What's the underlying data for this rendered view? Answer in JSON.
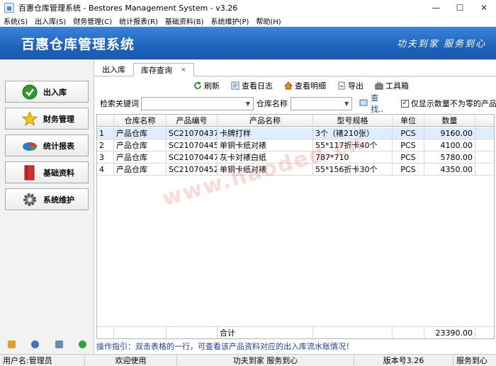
{
  "window": {
    "title": "百惠仓库管理系统 - Bestores Management System - v3.26",
    "minimize": "—",
    "maximize": "☐",
    "close": "✕"
  },
  "menu": [
    "系统(S)",
    "出入库(S)",
    "财务管理(C)",
    "统计报表(R)",
    "基础资料(B)",
    "系统维护(P)",
    "帮助(H)"
  ],
  "banner": {
    "title": "百惠仓库管理系统",
    "slogan": "功夫到家 服务到心"
  },
  "sidebar": {
    "buttons": [
      {
        "label": "出入库",
        "icon": "check-icon"
      },
      {
        "label": "财务管理",
        "icon": "star-icon"
      },
      {
        "label": "统计报表",
        "icon": "pie-chart-icon"
      },
      {
        "label": "基础资料",
        "icon": "book-icon"
      },
      {
        "label": "系统维护",
        "icon": "gear-icon"
      }
    ]
  },
  "tabs": [
    {
      "label": "出入库"
    },
    {
      "label": "库存查询",
      "close": "×"
    }
  ],
  "toolbar": {
    "refresh": "刷新",
    "view_log": "查看日志",
    "view_detail": "查看明细",
    "export": "导出",
    "toolbox": "工具箱"
  },
  "search": {
    "keyword_label": "检索关键词",
    "keyword_value": "",
    "warehouse_label": "仓库名称",
    "warehouse_value": "",
    "find": "查找..",
    "checkbox_label": "仅显示数量不为零的产品",
    "checkbox_checked": true
  },
  "table": {
    "headers": [
      "",
      "仓库名称",
      "产品编号",
      "产品名称",
      "型号规格",
      "单位",
      "数量"
    ],
    "rows": [
      [
        "1",
        "产品仓库",
        "SC21070437",
        "卡牌打样",
        "3个（裱210张）",
        "PCS",
        "9160.00"
      ],
      [
        "2",
        "产品仓库",
        "SC21070445",
        "单铜卡纸对裱",
        "55*117折卡40个",
        "PCS",
        "4100.00"
      ],
      [
        "3",
        "产品仓库",
        "SC21070447",
        "灰卡对裱白纸",
        "787*710",
        "PCS",
        "5780.00"
      ],
      [
        "4",
        "产品仓库",
        "SC21070452",
        "单铜卡纸对裱",
        "55*156折卡30个",
        "PCS",
        "4350.00"
      ]
    ],
    "total_label": "合计",
    "total_value": "23390.00"
  },
  "guide": "操作指引：双击表格的一行，可查看该产品资料对应的出入库流水账情况！",
  "status": {
    "user": "用户名:管理员",
    "welcome": "欢迎使用",
    "slogan": "功夫到家 服务到心",
    "version": "版本号3.26",
    "service": "服务到心"
  },
  "watermark": "www.haoded.cn",
  "colors": {
    "banner": "#1f63bd",
    "selected_row": "#ddeeff",
    "guide_text": "#1f3fa8"
  }
}
